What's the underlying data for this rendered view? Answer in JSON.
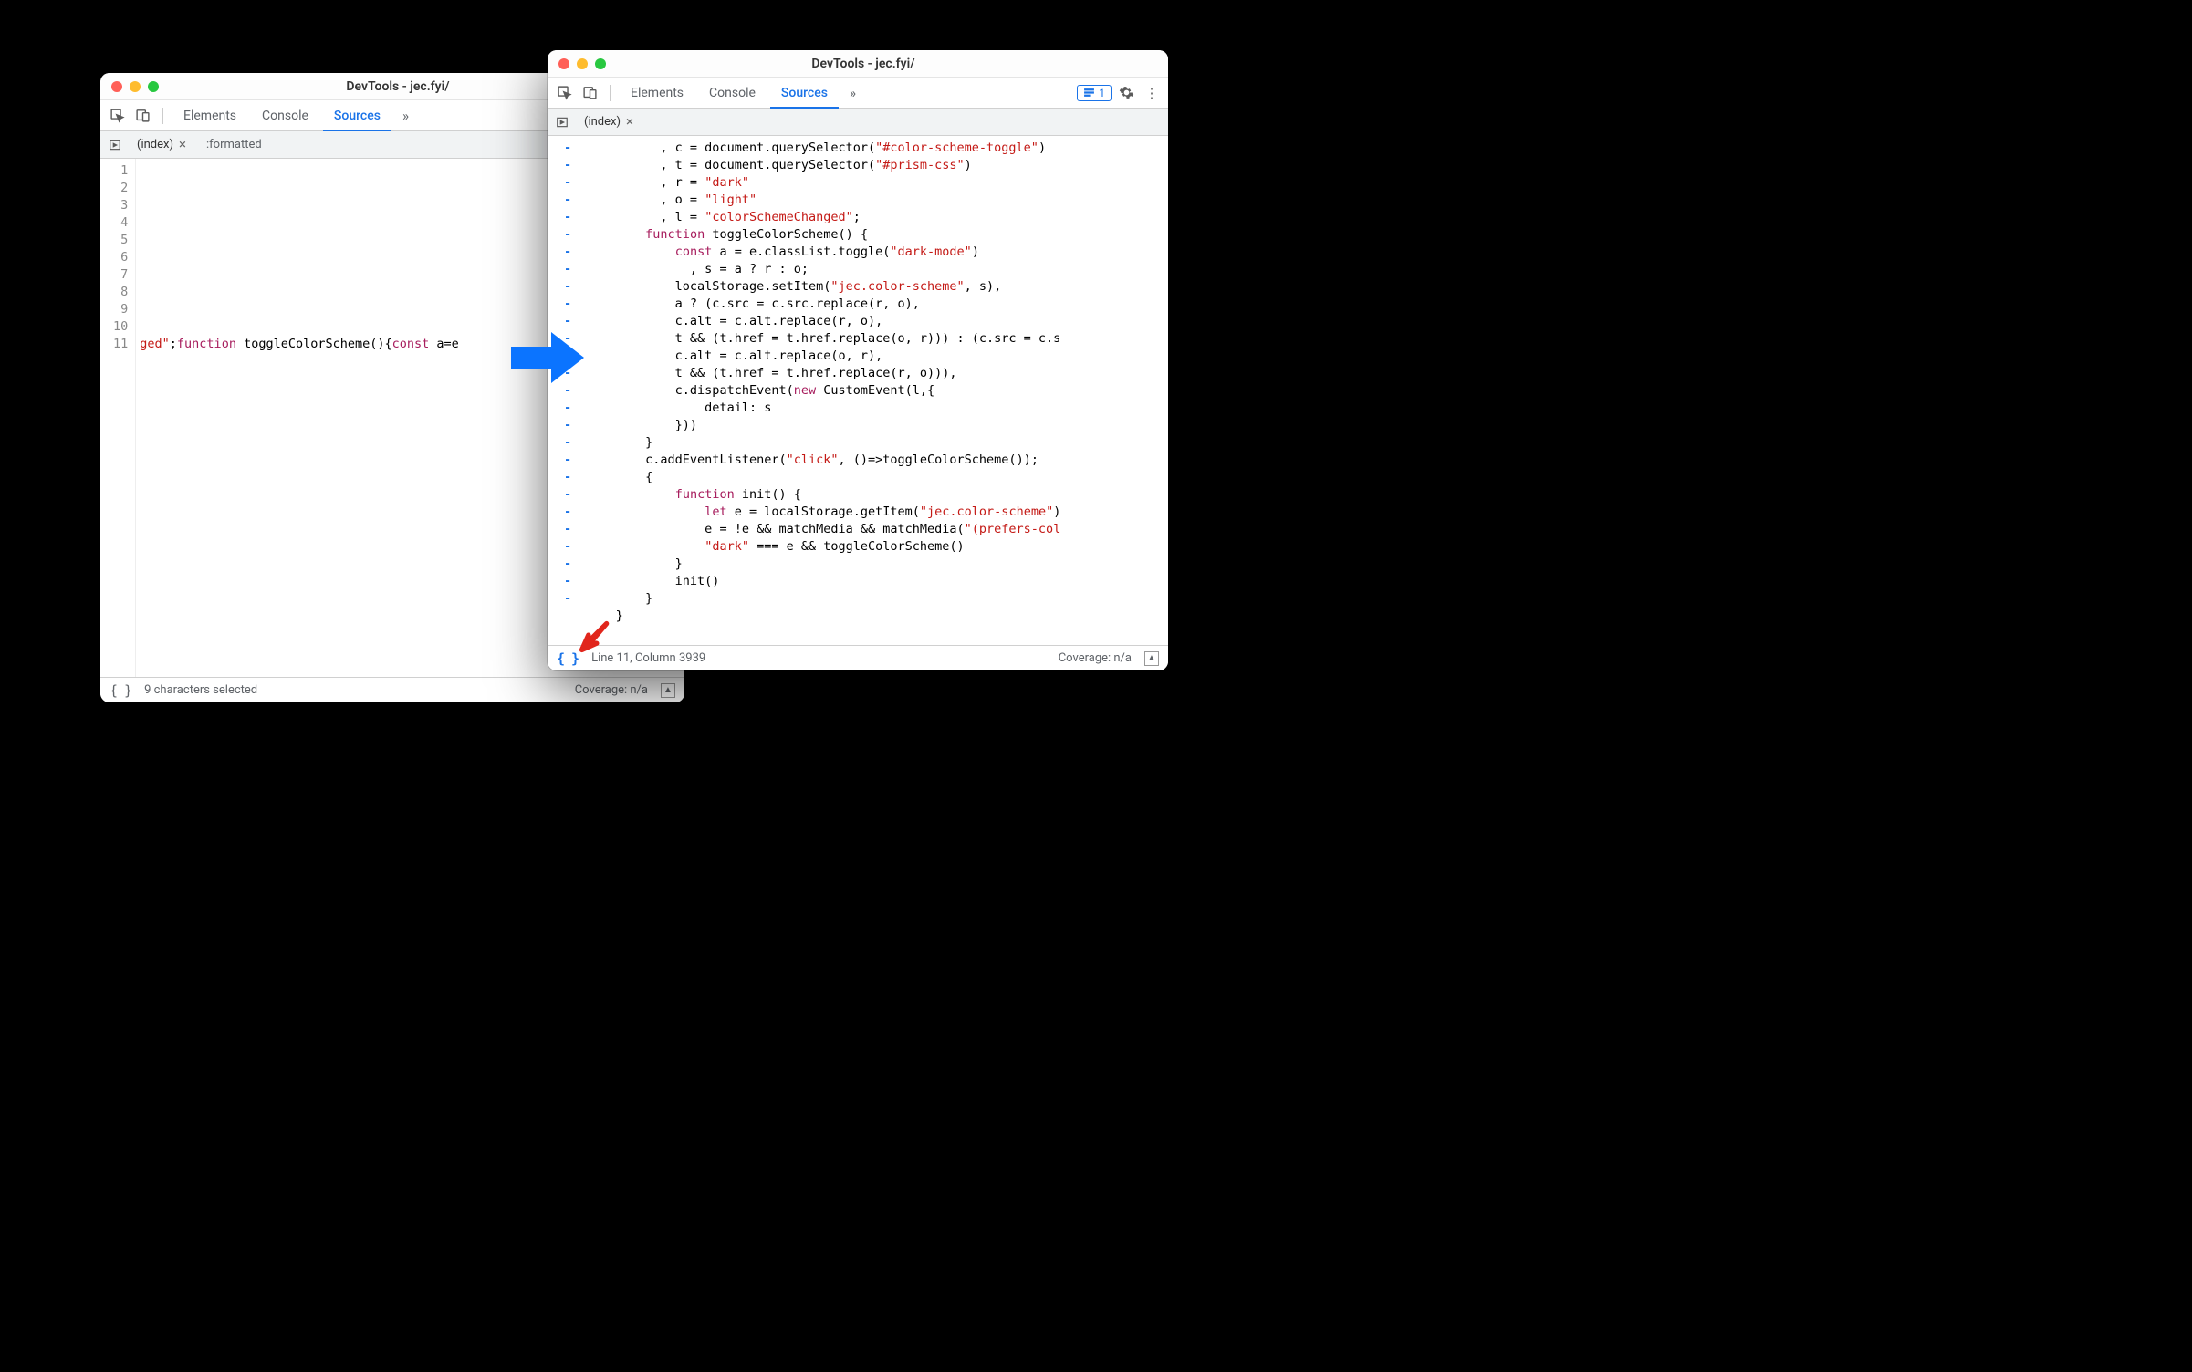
{
  "left": {
    "title": "DevTools - jec.fyi/",
    "tabs": {
      "elements": "Elements",
      "console": "Console",
      "sources": "Sources"
    },
    "filetabs": {
      "index": "(index)",
      "formatted": ":formatted"
    },
    "gutter": " 1\n 2\n 3\n 4\n 5\n 6\n 7\n 8\n 9\n10\n11",
    "code_prefix": "ged\"",
    "code_kw1": "function",
    "code_fnname": " toggleColorScheme(){",
    "code_kw2": "const",
    "code_tail": " a=e",
    "status": {
      "pp": "{ }",
      "selection": "9 characters selected",
      "coverage": "Coverage: n/a"
    }
  },
  "right": {
    "title": "DevTools - jec.fyi/",
    "tabs": {
      "elements": "Elements",
      "console": "Console",
      "sources": "Sources"
    },
    "notification_count": "1",
    "filetabs": {
      "index": "(index)"
    },
    "status": {
      "pp": "{ }",
      "position": "Line 11, Column 3939",
      "coverage": "Coverage: n/a"
    },
    "fold_lines": 27,
    "code": {
      "l1a": "          , c = document.querySelector(",
      "l1s": "\"#color-scheme-toggle\"",
      "l1b": ")",
      "l2a": "          , t = document.querySelector(",
      "l2s": "\"#prism-css\"",
      "l2b": ")",
      "l3a": "          , r = ",
      "l3s": "\"dark\"",
      "l4a": "          , o = ",
      "l4s": "\"light\"",
      "l5a": "          , l = ",
      "l5s": "\"colorSchemeChanged\"",
      "l5b": ";",
      "l6a": "        ",
      "l6k": "function",
      "l6b": " toggleColorScheme() {",
      "l7a": "            ",
      "l7k": "const",
      "l7b": " a = e.classList.toggle(",
      "l7s": "\"dark-mode\"",
      "l7c": ")",
      "l8": "              , s = a ? r : o;",
      "l9a": "            localStorage.setItem(",
      "l9s": "\"jec.color-scheme\"",
      "l9b": ", s),",
      "l10": "            a ? (c.src = c.src.replace(r, o),",
      "l11": "            c.alt = c.alt.replace(r, o),",
      "l12": "            t && (t.href = t.href.replace(o, r))) : (c.src = c.s",
      "l13": "            c.alt = c.alt.replace(o, r),",
      "l14": "            t && (t.href = t.href.replace(r, o))),",
      "l15a": "            c.dispatchEvent(",
      "l15k": "new",
      "l15b": " CustomEvent(l,{",
      "l16": "                detail: s",
      "l17": "            }))",
      "l18": "        }",
      "l19a": "        c.addEventListener(",
      "l19s": "\"click\"",
      "l19b": ", ()=>toggleColorScheme());",
      "l20": "        {",
      "l21a": "            ",
      "l21k": "function",
      "l21b": " init() {",
      "l22a": "                ",
      "l22k": "let",
      "l22b": " e = localStorage.getItem(",
      "l22s": "\"jec.color-scheme\"",
      "l22c": ")",
      "l23a": "                e = !e && matchMedia && matchMedia(",
      "l23s": "\"(prefers-col",
      "l24a": "                ",
      "l24s": "\"dark\"",
      "l24b": " === e && toggleColorScheme()",
      "l25": "            }",
      "l26": "            init()",
      "l27": "        }",
      "l28": "    }"
    }
  }
}
